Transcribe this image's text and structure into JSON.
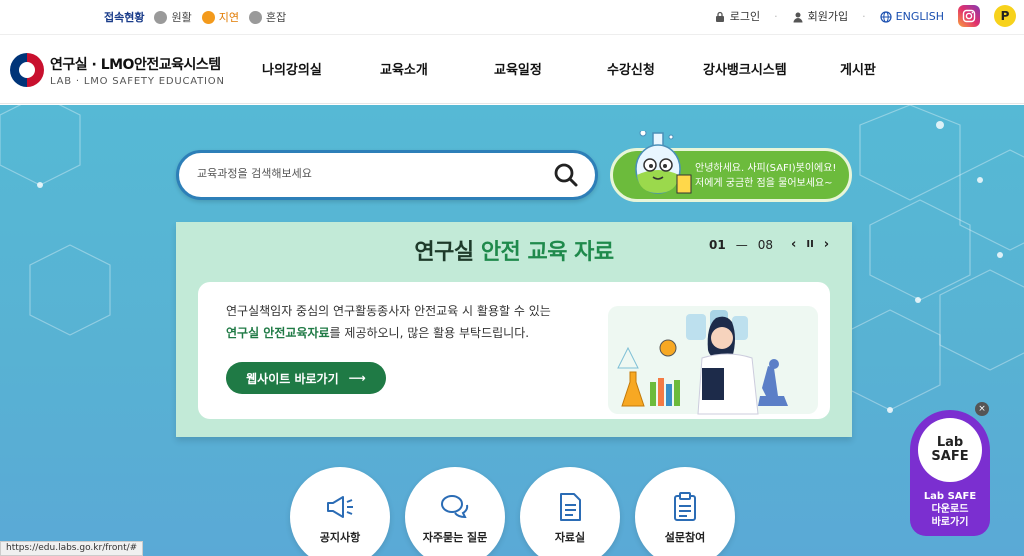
{
  "topbar": {
    "status_title": "접속현황",
    "status_items": [
      {
        "label": "원활",
        "color": "#9a9a9a"
      },
      {
        "label": "지연",
        "color": "#f39a1c"
      },
      {
        "label": "혼잡",
        "color": "#9a9a9a"
      }
    ],
    "login": "로그인",
    "signup": "회원가입",
    "english": "ENGLISH",
    "p_label": "P"
  },
  "header": {
    "logo_title": "연구실 · LMO안전교육시스템",
    "logo_sub": "LAB · LMO SAFETY EDUCATION",
    "nav": [
      "나의강의실",
      "교육소개",
      "교육일정",
      "수강신청",
      "강사뱅크시스템",
      "게시판"
    ]
  },
  "search": {
    "placeholder": "교육과정을 검색해보세요"
  },
  "safi": {
    "line1": "안녕하세요. 사피(SAFI)봇이에요!",
    "line2": "저에게 궁금한 점을 물어보세요~"
  },
  "banner": {
    "title_a": "연구실 ",
    "title_b": "안전 교육 자료",
    "pager_current": "01",
    "pager_sep": "—",
    "pager_total": "08",
    "prev": "‹",
    "pause": "II",
    "next": "›",
    "line1": "연구실책임자 중심의 연구활동종사자 안전교육 시 활용할 수 있는",
    "line2_hl": "연구실 안전교육자료",
    "line2_rest": "를 제공하오니, 많은 활용 부탁드립니다.",
    "button": "웹사이트 바로가기",
    "button_arrow": "⟶"
  },
  "quick_links": [
    "공지사항",
    "자주묻는 질문",
    "자료실",
    "설문참여"
  ],
  "labsafe": {
    "logo_line1": "Lab",
    "logo_line2": "SAFE",
    "text1": "Lab SAFE",
    "text2": "다운로드",
    "text3": "바로가기",
    "close": "×"
  },
  "statusbar": {
    "url": "https://edu.labs.go.kr/front/#"
  }
}
